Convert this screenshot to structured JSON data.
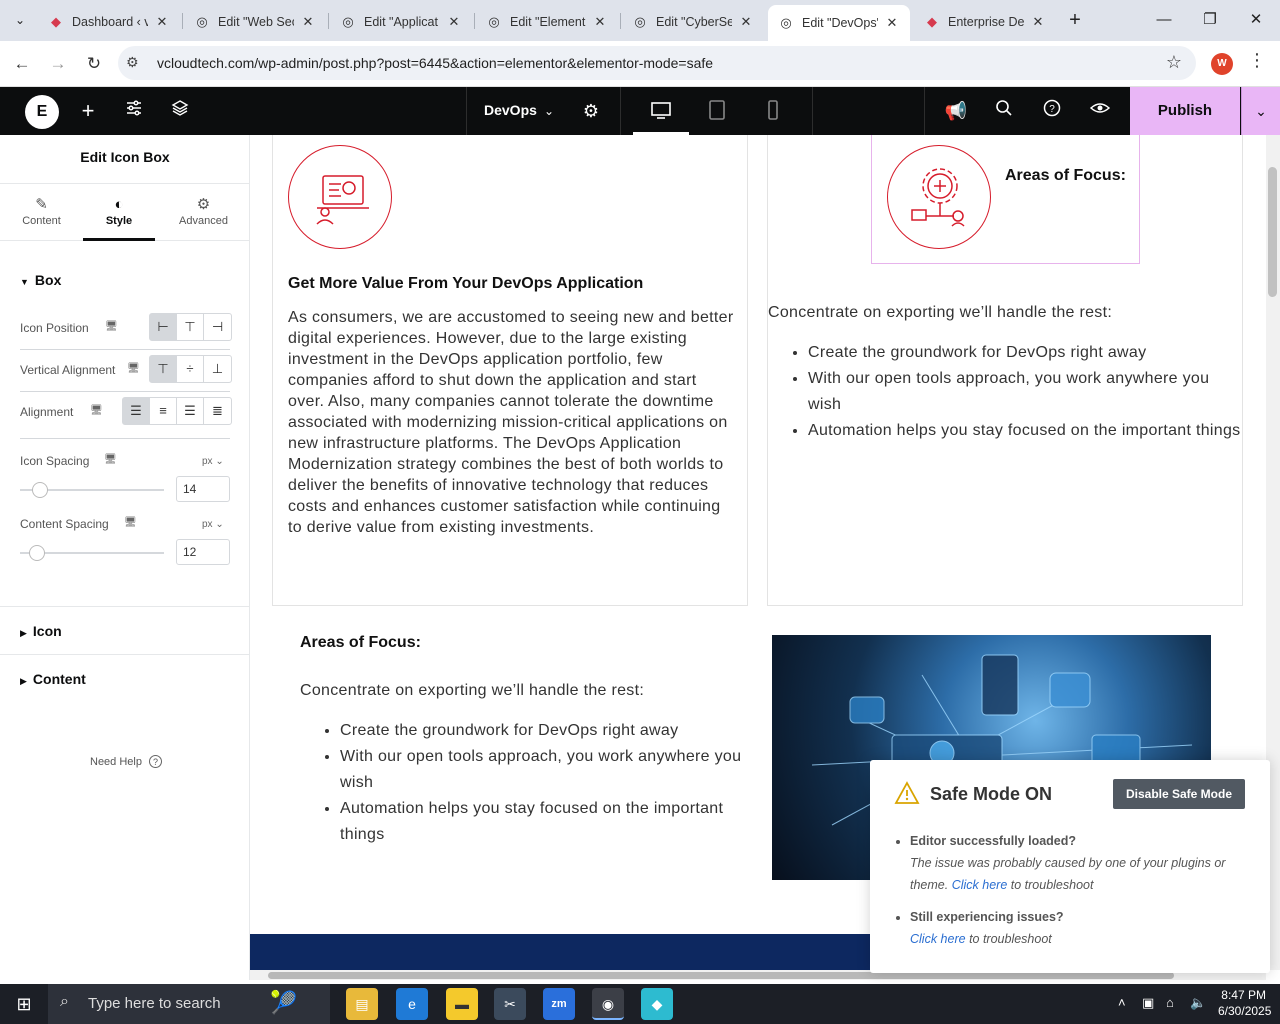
{
  "browser": {
    "tabs": [
      {
        "title": "Dashboard ‹ v"
      },
      {
        "title": "Edit \"Web Sec"
      },
      {
        "title": "Edit \"Applicat"
      },
      {
        "title": "Edit \"Element"
      },
      {
        "title": "Edit \"CyberSe"
      },
      {
        "title": "Edit \"DevOps\""
      },
      {
        "title": "Enterprise De"
      }
    ],
    "url": "vcloudtech.com/wp-admin/post.php?post=6445&action=elementor&elementor-mode=safe",
    "profile_initial": "W"
  },
  "editor": {
    "page_name": "DevOps",
    "publish_label": "Publish"
  },
  "panel": {
    "title": "Edit Icon Box",
    "tabs": [
      {
        "label": "Content",
        "icon": "pencil-icon"
      },
      {
        "label": "Style",
        "icon": "contrast-icon"
      },
      {
        "label": "Advanced",
        "icon": "gear-icon"
      }
    ],
    "active_tab": "Style",
    "section_box": "Box",
    "icon_position_label": "Icon Position",
    "vertical_alignment_label": "Vertical Alignment",
    "alignment_label": "Alignment",
    "icon_spacing_label": "Icon Spacing",
    "icon_spacing_unit": "px",
    "icon_spacing_value": "14",
    "content_spacing_label": "Content Spacing",
    "content_spacing_unit": "px",
    "content_spacing_value": "12",
    "section_icon": "Icon",
    "section_content": "Content",
    "need_help": "Need Help"
  },
  "canvas": {
    "left_card": {
      "heading": "Get More Value From Your DevOps Application",
      "body": "As consumers, we are accustomed to seeing new and better digital experiences. However, due to the large existing investment in the DevOps application portfolio, few companies afford to shut down the application and start over. Also, many companies cannot tolerate the downtime associated with modernizing mission-critical applications on new infrastructure platforms. The DevOps Application Modernization strategy combines the best of both worlds to deliver the benefits of innovative technology that reduces costs and enhances customer satisfaction while continuing to derive value from existing investments."
    },
    "right_card": {
      "icon_box_title": "Areas of Focus:",
      "intro": "Concentrate on exporting we’ll handle the rest:",
      "bullets": [
        "Create the groundwork for DevOps right away",
        "With our open tools approach, you work anywhere you wish",
        "Automation helps you stay focused on the important things"
      ]
    },
    "lower_section": {
      "heading": "Areas of Focus:",
      "intro": "Concentrate on exporting we’ll handle the rest:",
      "bullets": [
        "Create the groundwork for DevOps right away",
        "With our open tools approach, you work anywhere you wish",
        "Automation helps you stay focused on the important things"
      ]
    }
  },
  "safe_mode": {
    "title": "Safe Mode ON",
    "disable_label": "Disable Safe Mode",
    "q1": "Editor successfully loaded?",
    "a1_text": "The issue was probably caused by one of your plugins or theme.",
    "a1_link": "Click here",
    "a1_suffix": "to troubleshoot",
    "q2": "Still experiencing issues?",
    "a2_link": "Click here",
    "a2_suffix": "to troubleshoot"
  },
  "taskbar": {
    "search_placeholder": "Type here to search",
    "time": "8:47 PM",
    "date": "6/30/2025"
  },
  "colors": {
    "accent_red": "#d61c2b",
    "publish_bg": "#e9b6f6",
    "editor_bar": "#0c0d0e"
  }
}
